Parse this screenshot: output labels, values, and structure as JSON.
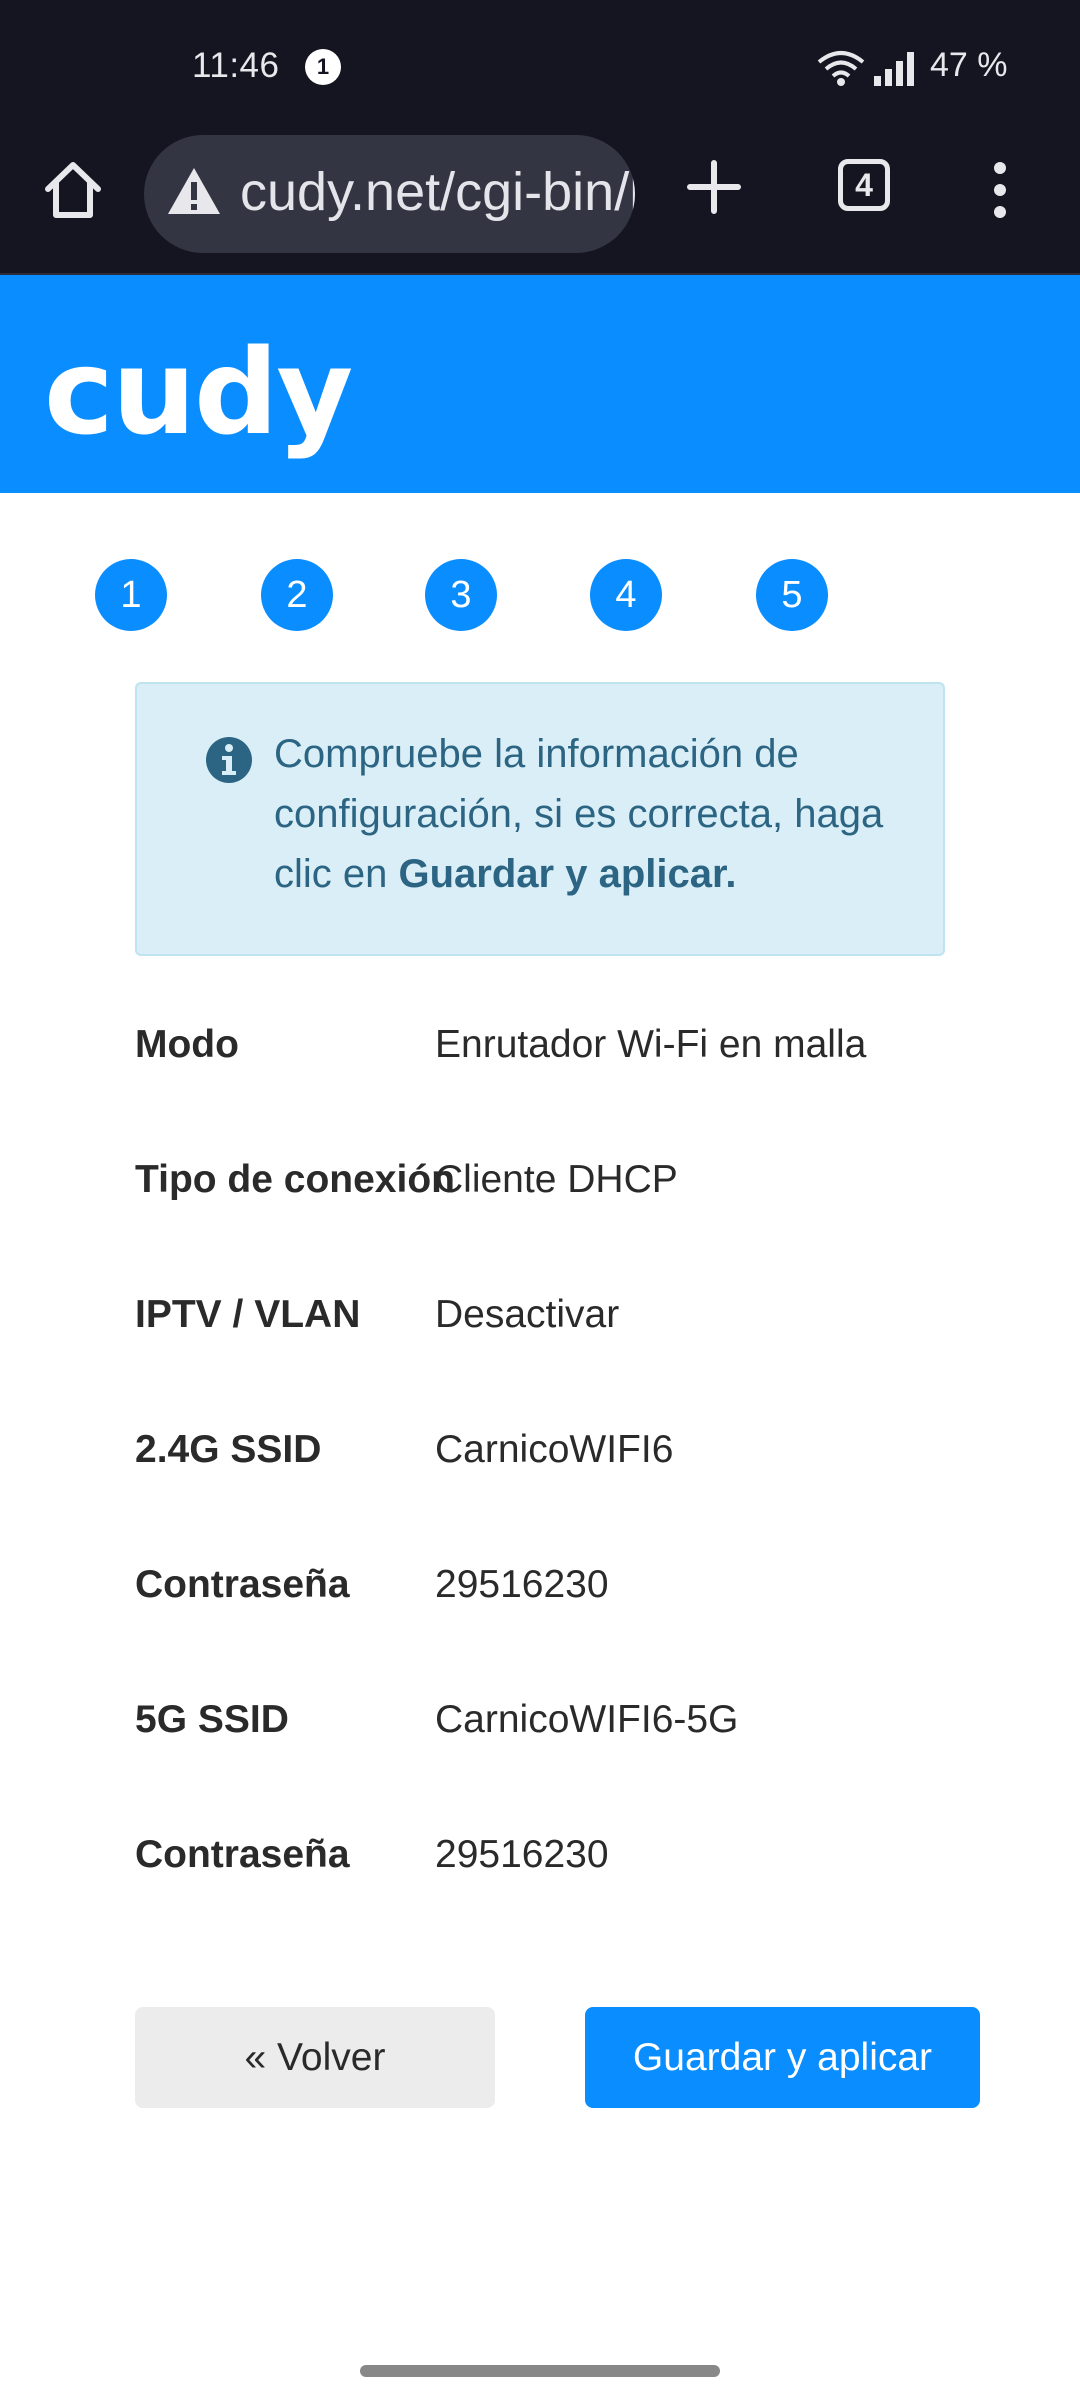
{
  "status_bar": {
    "time": "11:46",
    "notification_count": "1",
    "battery": "47 %"
  },
  "browser": {
    "url": "cudy.net/cgi-bin/luci/admin/setup",
    "tab_count": "4"
  },
  "header": {
    "logo": "cudy"
  },
  "steps": [
    "1",
    "2",
    "3",
    "4",
    "5"
  ],
  "info": {
    "text": "Compruebe la información de configuración, si es correcta, haga clic en ",
    "bold": "Guardar y aplicar."
  },
  "summary": [
    {
      "label": "Modo",
      "value": "Enrutador Wi-Fi en malla"
    },
    {
      "label": "Tipo de conexión",
      "value": "Cliente DHCP"
    },
    {
      "label": "IPTV / VLAN",
      "value": "Desactivar"
    },
    {
      "label": "2.4G SSID",
      "value": "CarnicoWIFI6"
    },
    {
      "label": "Contraseña",
      "value": "29516230"
    },
    {
      "label": "5G SSID",
      "value": "CarnicoWIFI6-5G"
    },
    {
      "label": "Contraseña",
      "value": "29516230"
    }
  ],
  "buttons": {
    "back": "« Volver",
    "save": "Guardar y aplicar"
  },
  "colors": {
    "brand_blue": "#0a8dff",
    "system_bar": "#141520",
    "info_bg": "#d9eef6",
    "info_text": "#2c6583"
  }
}
